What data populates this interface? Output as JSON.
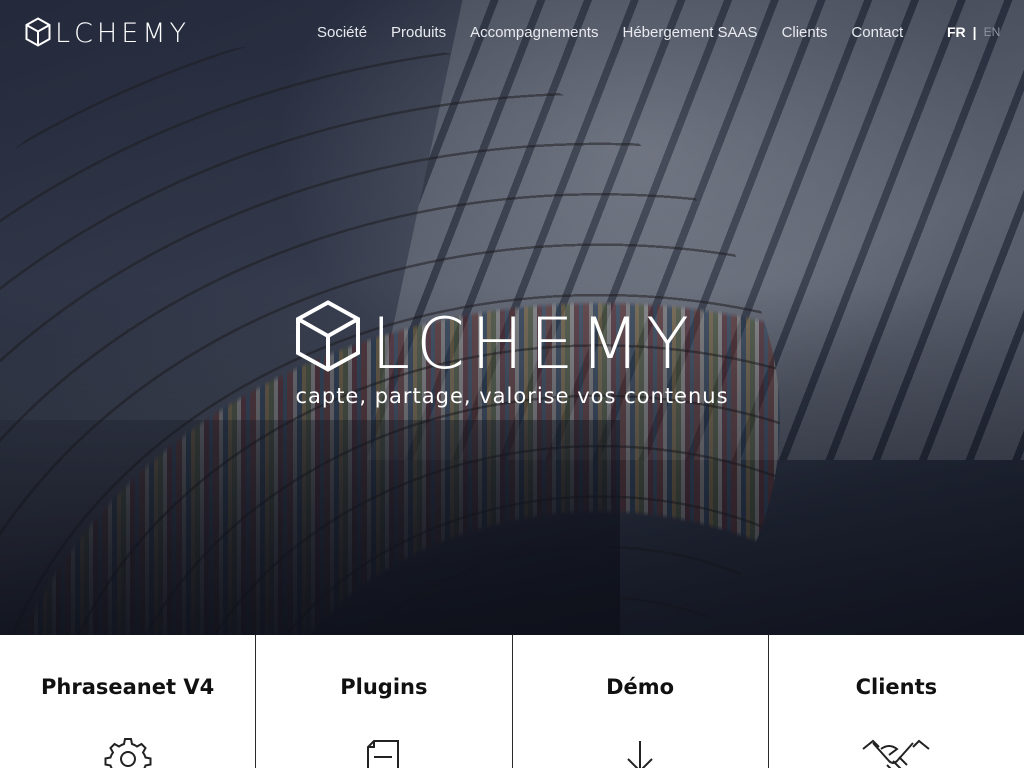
{
  "brand": {
    "wordmark": "LCHEMY"
  },
  "nav": {
    "items": [
      {
        "label": "Société"
      },
      {
        "label": "Produits"
      },
      {
        "label": "Accompagnements"
      },
      {
        "label": "Hébergement SAAS"
      },
      {
        "label": "Clients"
      },
      {
        "label": "Contact"
      }
    ],
    "lang": {
      "fr": "FR",
      "sep": "|",
      "en": "EN"
    }
  },
  "hero": {
    "wordmark": "LCHEMY",
    "tagline": "capte, partage, valorise vos contenus"
  },
  "cards": [
    {
      "title": "Phraseanet V4",
      "icon": "gear-icon"
    },
    {
      "title": "Plugins",
      "icon": "document-icon"
    },
    {
      "title": "Démo",
      "icon": "download-arrow-icon"
    },
    {
      "title": "Clients",
      "icon": "handshake-icon"
    }
  ]
}
